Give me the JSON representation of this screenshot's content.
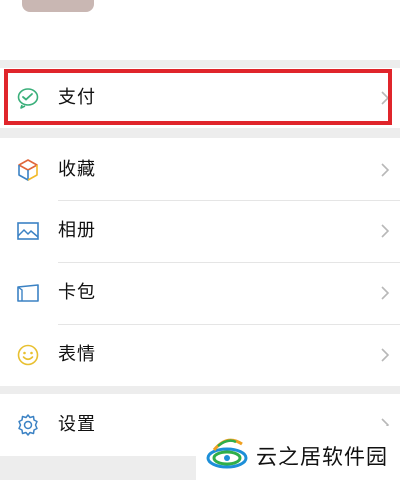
{
  "menu": {
    "pay": {
      "label": "支付",
      "icon": "wechat-pay-icon"
    },
    "favorites": {
      "label": "收藏",
      "icon": "cube-icon"
    },
    "album": {
      "label": "相册",
      "icon": "image-icon"
    },
    "cards": {
      "label": "卡包",
      "icon": "wallet-icon"
    },
    "stickers": {
      "label": "表情",
      "icon": "smiley-icon"
    },
    "settings": {
      "label": "设置",
      "icon": "gear-icon"
    }
  },
  "watermark": {
    "text": "云之居软件园"
  },
  "colors": {
    "highlight": "#e0252b",
    "pay_icon": "#3aaf7a",
    "background": "#ededed"
  }
}
